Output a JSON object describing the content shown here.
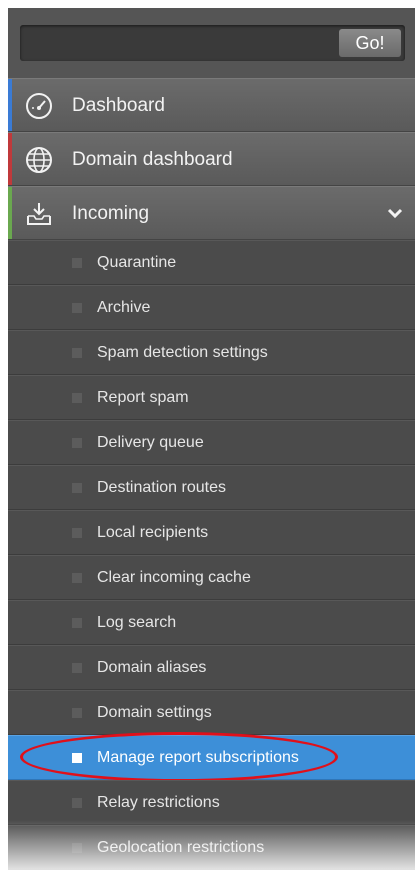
{
  "search": {
    "placeholder": "",
    "value": "",
    "go_label": "Go!"
  },
  "nav": [
    {
      "label": "Dashboard",
      "icon": "gauge-icon",
      "stripe": "#3a7bd5"
    },
    {
      "label": "Domain dashboard",
      "icon": "globe-icon",
      "stripe": "#c0393b"
    },
    {
      "label": "Incoming",
      "icon": "inbox-download-icon",
      "stripe": "#6aa84f",
      "expanded": true
    }
  ],
  "incoming_items": [
    {
      "label": "Quarantine"
    },
    {
      "label": "Archive"
    },
    {
      "label": "Spam detection settings"
    },
    {
      "label": "Report spam"
    },
    {
      "label": "Delivery queue"
    },
    {
      "label": "Destination routes"
    },
    {
      "label": "Local recipients"
    },
    {
      "label": "Clear incoming cache"
    },
    {
      "label": "Log search"
    },
    {
      "label": "Domain aliases"
    },
    {
      "label": "Domain settings"
    },
    {
      "label": "Manage report subscriptions",
      "active": true
    },
    {
      "label": "Relay restrictions"
    },
    {
      "label": "Geolocation restrictions"
    }
  ],
  "colors": {
    "active_bg": "#3d8fd8",
    "highlight_ring": "#e0101a"
  }
}
